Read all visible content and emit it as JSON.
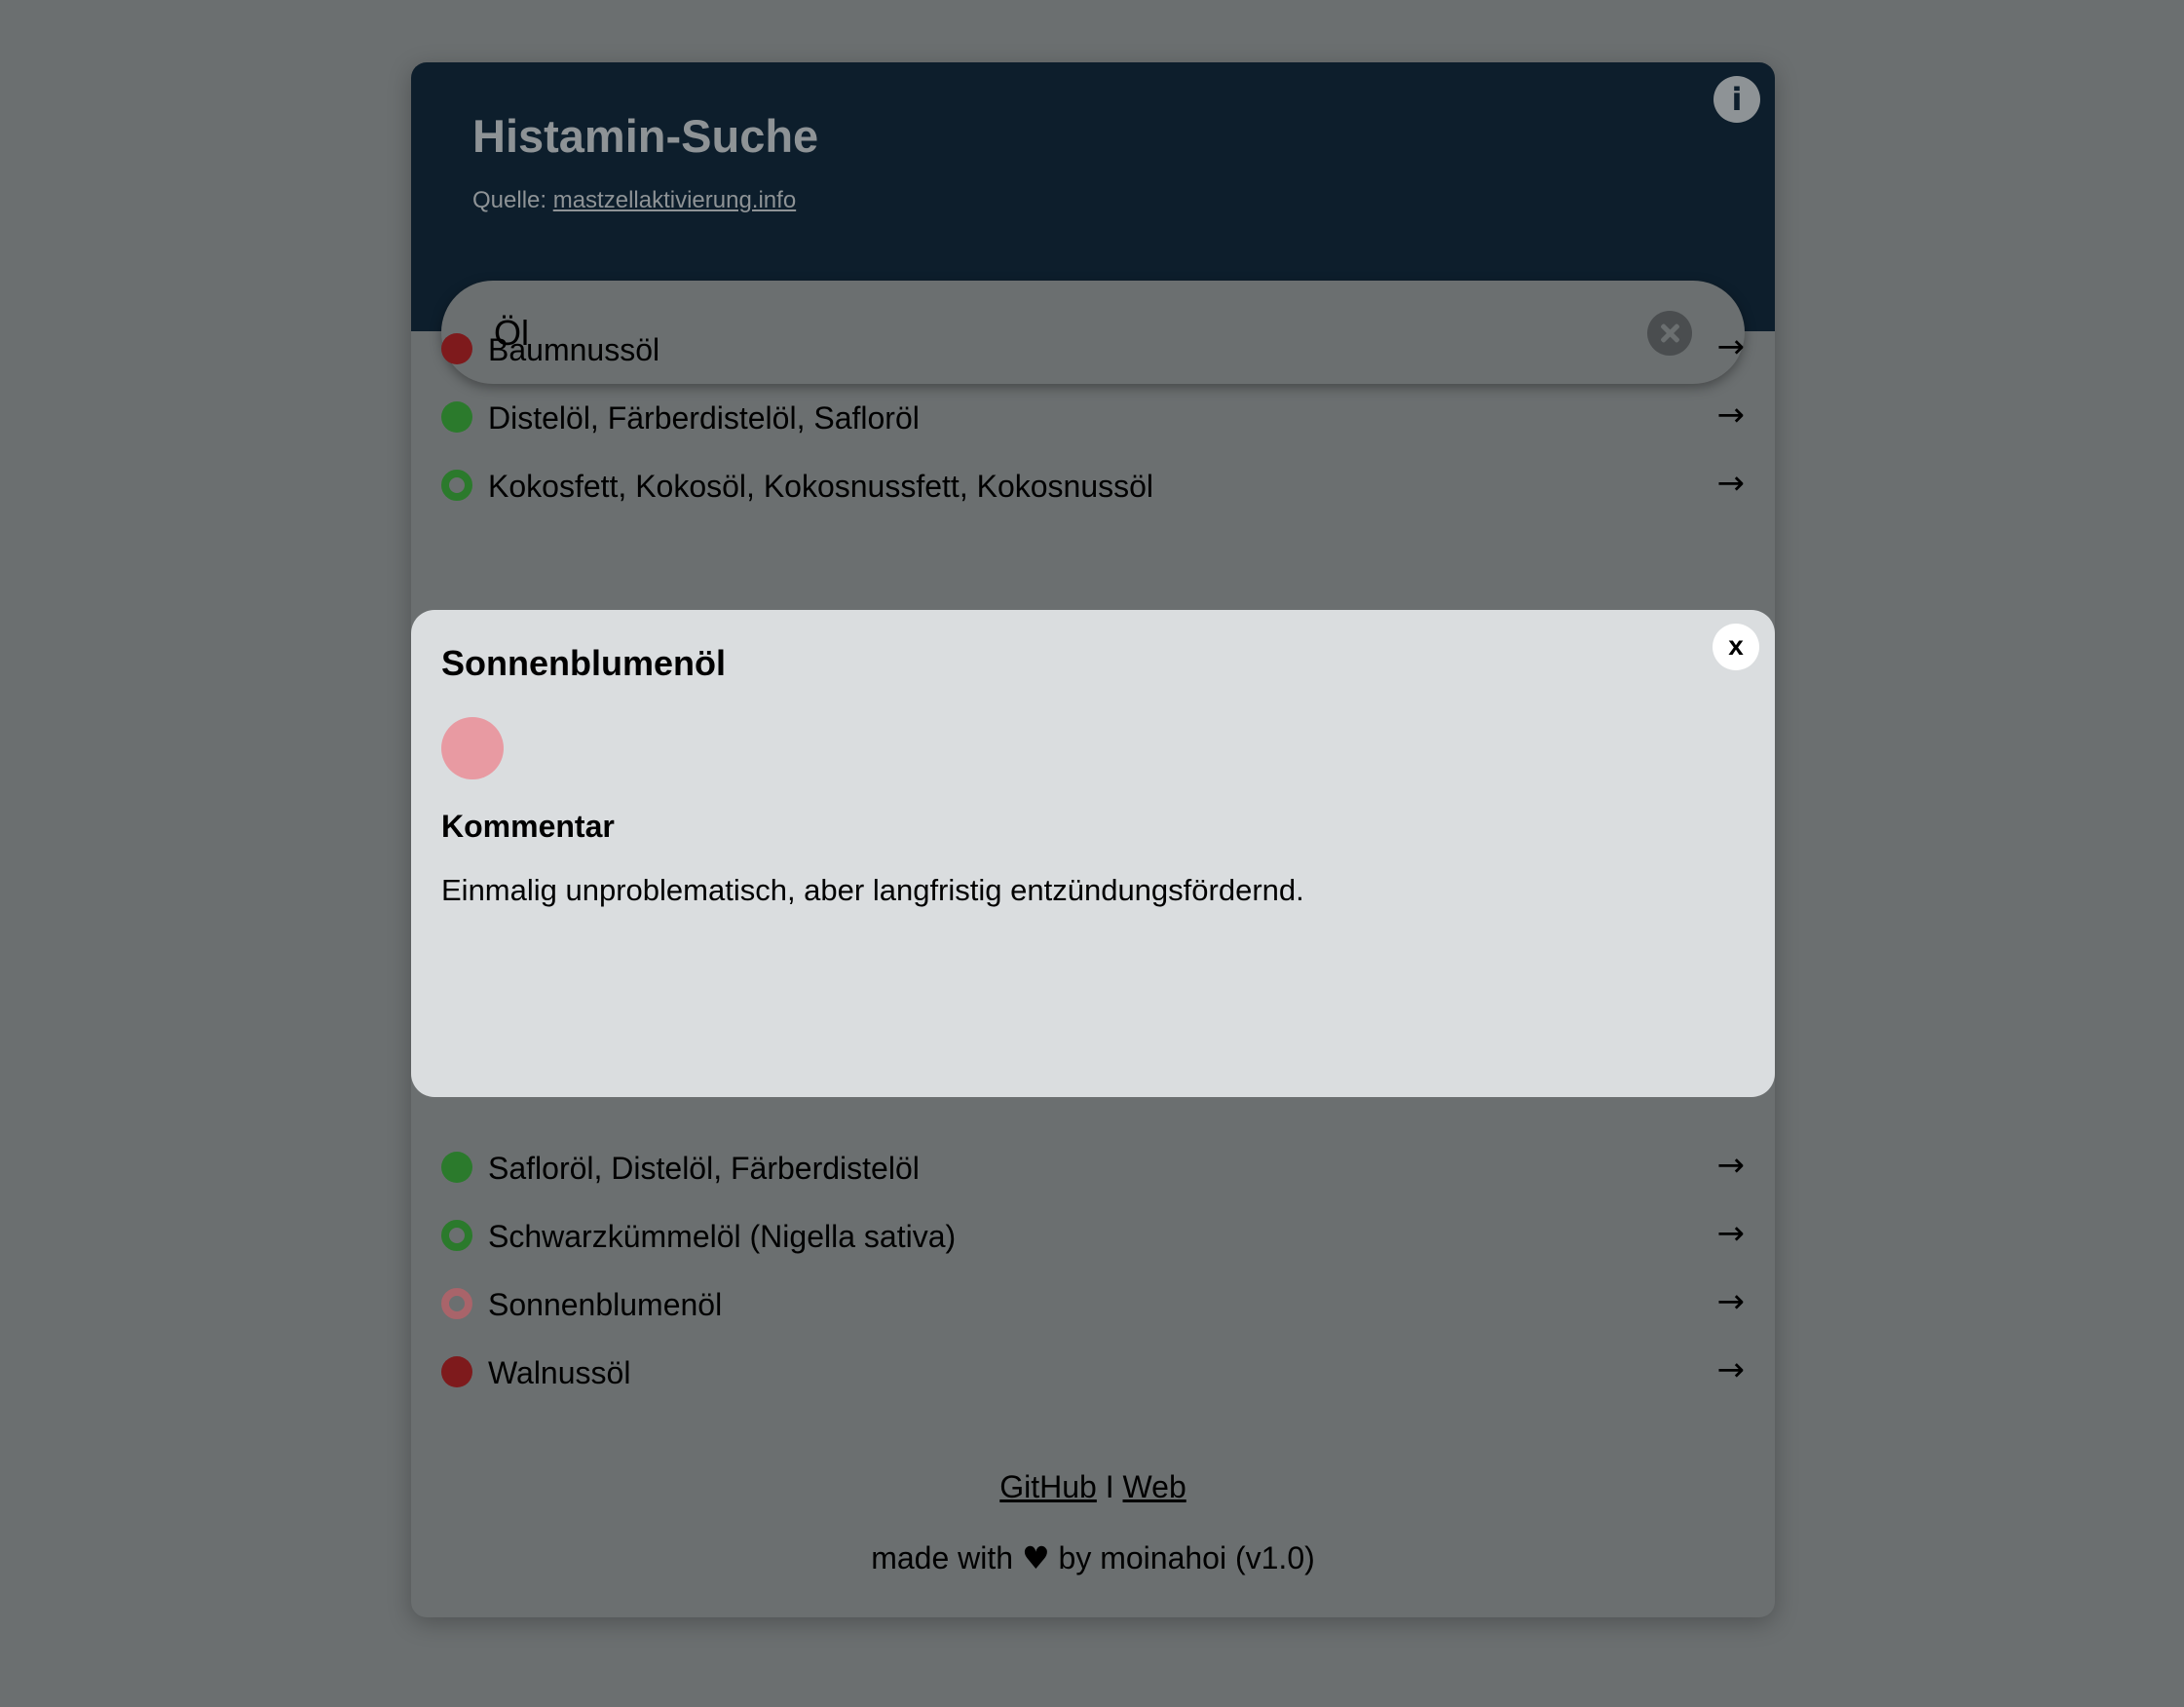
{
  "header": {
    "title": "Histamin-Suche",
    "source_prefix": "Quelle:",
    "source_link": "mastzellaktivierung.info",
    "info_label": "i"
  },
  "search": {
    "value": "Öl"
  },
  "results": [
    {
      "label": "Baumnussöl",
      "status": "red-filled",
      "arrow": "→"
    },
    {
      "label": "Distelöl, Färberdistelöl, Safloröl",
      "status": "green-filled",
      "arrow": "→"
    },
    {
      "label": "Kokosfett, Kokosöl, Kokosnussfett, Kokosnussöl",
      "status": "green-ring",
      "arrow": "→"
    },
    {
      "label": "Safloröl, Distelöl, Färberdistelöl",
      "status": "green-filled",
      "arrow": "→"
    },
    {
      "label": "Schwarzkümmelöl (Nigella sativa)",
      "status": "green-ring",
      "arrow": "→"
    },
    {
      "label": "Sonnenblumenöl",
      "status": "pink-ring",
      "arrow": "→"
    },
    {
      "label": "Walnussöl",
      "status": "red-filled",
      "arrow": "→"
    }
  ],
  "footer": {
    "github": "GitHub",
    "separator": "I",
    "web": "Web",
    "made_with_prefix": "made with",
    "heart": "♥",
    "made_with_suffix": "by moinahoi (v1.0)"
  },
  "modal": {
    "title": "Sonnenblumenöl",
    "close_label": "x",
    "comment_heading": "Kommentar",
    "comment": "Einmalig unproblematisch, aber langfristig entzündungsfördernd.",
    "indicator_color": "#e89aa2"
  },
  "colors": {
    "header_bg": "#0d1e2c",
    "red": "#7e1a1c",
    "green": "#2b7a2c",
    "pink": "#a9646a",
    "modal_bg": "#dadddf"
  }
}
